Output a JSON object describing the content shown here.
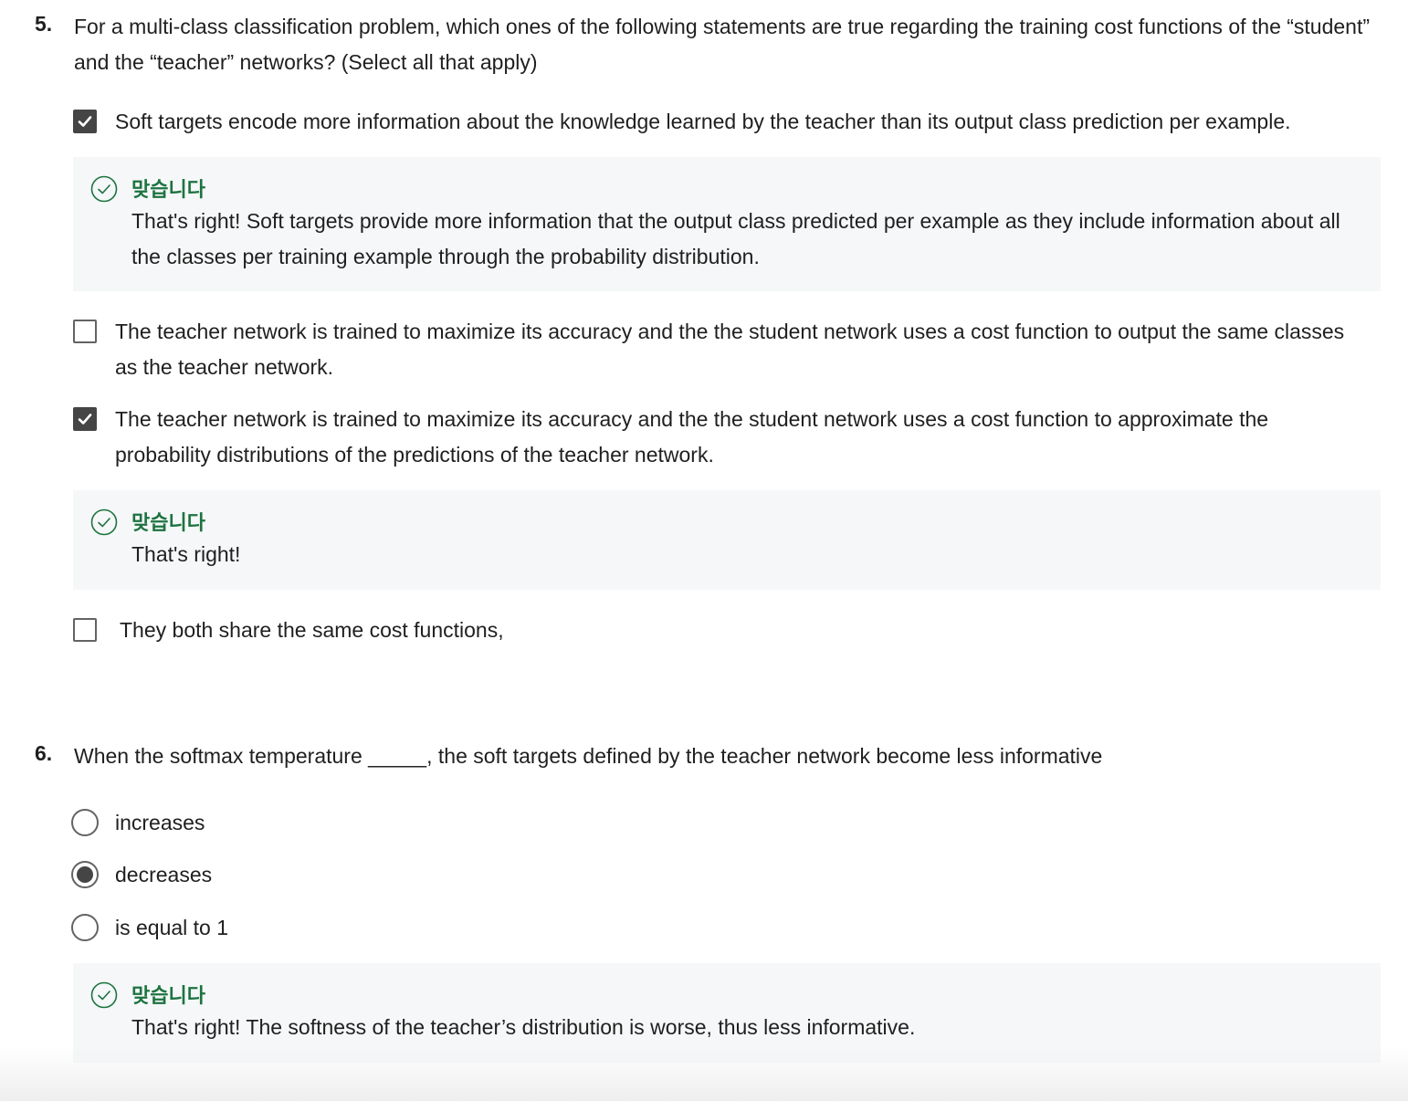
{
  "q5": {
    "number": "5.",
    "prompt": "For a multi-class classification problem, which ones of the following statements are true regarding the training cost functions of the “student” and the “teacher” networks? (Select all that apply)",
    "options": [
      {
        "label": "Soft targets encode more information about the knowledge learned by the teacher than its output class prediction per example.",
        "checked": true
      },
      {
        "label": "The teacher network is trained to maximize its accuracy and the the student network uses a cost function to output the same classes as the teacher network.",
        "checked": false
      },
      {
        "label": "The teacher network is trained to maximize its accuracy and the the student network uses a cost function to approximate the probability distributions of the predictions of the teacher network.",
        "checked": true
      },
      {
        "label": "They both share the same cost functions,",
        "checked": false
      }
    ],
    "feedback": [
      {
        "title": "맞습니다",
        "text": "That's right! Soft targets provide more information that the output class predicted per example as they include information about all the classes per training example through the probability distribution."
      },
      {
        "title": "맞습니다",
        "text": "That's right!"
      }
    ]
  },
  "q6": {
    "number": "6.",
    "prompt": "When the softmax temperature _____, the soft targets defined by the teacher network become less informative",
    "options": [
      {
        "label": "increases",
        "selected": false
      },
      {
        "label": "decreases",
        "selected": true
      },
      {
        "label": "is equal to 1",
        "selected": false
      }
    ],
    "feedback": [
      {
        "title": "맞습니다",
        "text": "That's right! The softness of the teacher’s distribution is worse, thus less informative."
      }
    ]
  },
  "colors": {
    "correct_green": "#1d7340",
    "feedback_bg": "#f5f7f8",
    "control_dark": "#454545"
  },
  "icons": {
    "checkbox_checked": "checkmark-icon",
    "feedback": "check-circle-icon"
  }
}
